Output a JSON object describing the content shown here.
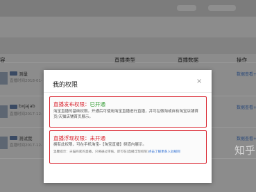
{
  "table": {
    "headers": {
      "content": "容",
      "type": "直播类型",
      "data": "直播数据",
      "action": "操作"
    },
    "rows": [
      {
        "title": "测量",
        "time": "直播时间2018-01-",
        "action": "数据查看+"
      },
      {
        "title": "bxjajab",
        "time": "直播时间2017-12-",
        "action": "数据查看+"
      },
      {
        "title": "测试我",
        "time": "直播时间2017-12-",
        "action": "数据查看+"
      }
    ]
  },
  "modal": {
    "title": "我的权限",
    "close": "×",
    "live_permission": {
      "label": "直播发布权限：",
      "status": "已开通",
      "description": "淘宝直播的基础权限。开通后可使用淘宝直播进行直播，并可在微淘或自有淘宝店铺首页/天猫店铺首页展示。"
    },
    "float_permission": {
      "label": "直播浮现权限：",
      "status": "未开通",
      "description": "拥有此权限，可在手机淘宝-【淘宝直播】频道内展示。",
      "tip_prefix": "温馨提示：天猫商家的直播，只要通过审核，即可在[直播浮现权限]",
      "tip_link": "点击了解更多入驻规则"
    }
  },
  "watermark": "知乎"
}
